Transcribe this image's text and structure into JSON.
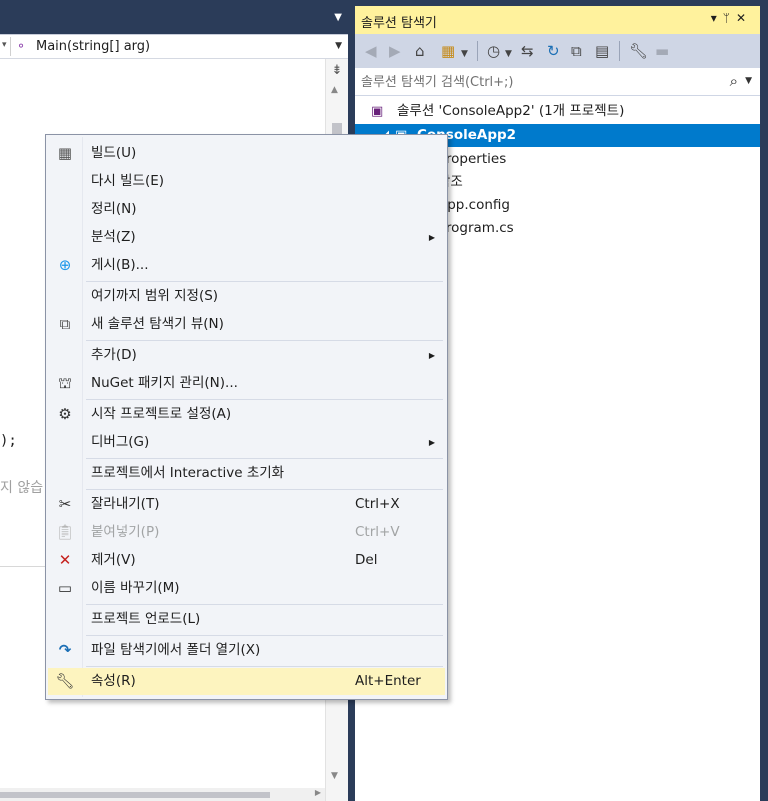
{
  "editor": {
    "member_dropdown": "Main(string[] arg)",
    "code_line_1": ");",
    "code_line_2": "지 않습"
  },
  "solution_explorer": {
    "title": "솔루션 탐색기",
    "search_placeholder": "솔루션 탐색기 검색(Ctrl+;)",
    "tree": [
      {
        "label": "솔루션 'ConsoleApp2' (1개 프로젝트)",
        "icon": "solution-icon"
      },
      {
        "label": "ConsoleApp2",
        "icon": "csharp-project-icon",
        "selected": true
      },
      {
        "label": "Properties",
        "icon": "properties-icon"
      },
      {
        "label": "참조",
        "icon": "references-icon"
      },
      {
        "label": "App.config",
        "icon": "config-file-icon"
      },
      {
        "label": "Program.cs",
        "icon": "csharp-file-icon"
      }
    ]
  },
  "context_menu": {
    "items": [
      {
        "label": "빌드(U)",
        "icon": "build-icon"
      },
      {
        "label": "다시 빌드(E)"
      },
      {
        "label": "정리(N)"
      },
      {
        "label": "분석(Z)",
        "submenu": true
      },
      {
        "label": "게시(B)...",
        "icon": "publish-globe-icon"
      },
      {
        "label": "여기까지 범위 지정(S)"
      },
      {
        "label": "새 솔루션 탐색기 뷰(N)",
        "icon": "new-view-icon"
      },
      {
        "label": "추가(D)",
        "submenu": true
      },
      {
        "label": "NuGet 패키지 관리(N)...",
        "icon": "nuget-icon"
      },
      {
        "label": "시작 프로젝트로 설정(A)",
        "icon": "gear-icon"
      },
      {
        "label": "디버그(G)",
        "submenu": true
      },
      {
        "label": "프로젝트에서 Interactive 초기화"
      },
      {
        "label": "잘라내기(T)",
        "shortcut": "Ctrl+X",
        "icon": "cut-icon"
      },
      {
        "label": "붙여넣기(P)",
        "shortcut": "Ctrl+V",
        "icon": "paste-icon",
        "disabled": true
      },
      {
        "label": "제거(V)",
        "shortcut": "Del",
        "icon": "remove-x-icon"
      },
      {
        "label": "이름 바꾸기(M)",
        "icon": "rename-icon"
      },
      {
        "label": "프로젝트 언로드(L)"
      },
      {
        "label": "파일 탐색기에서 폴더 열기(X)",
        "icon": "open-folder-arrow-icon"
      },
      {
        "label": "속성(R)",
        "shortcut": "Alt+Enter",
        "icon": "wrench-icon",
        "highlighted": true
      }
    ]
  }
}
